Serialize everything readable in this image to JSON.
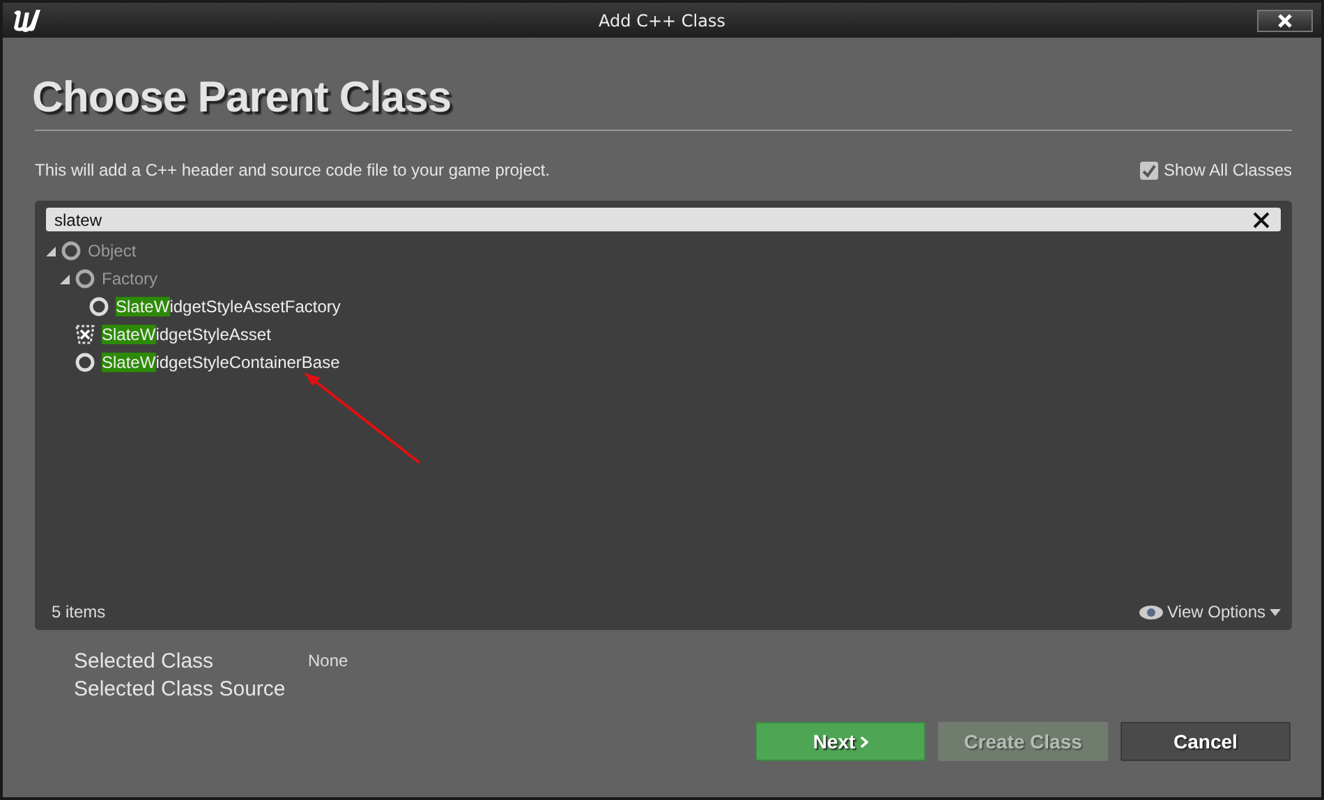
{
  "window": {
    "title": "Add C++ Class"
  },
  "heading": "Choose Parent Class",
  "description": "This will add a C++ header and source code file to your game project.",
  "show_all_classes": {
    "label": "Show All Classes",
    "checked": true
  },
  "search": {
    "value": "slatew"
  },
  "tree": [
    {
      "label_rest": "Object",
      "dimmed": true,
      "expanded": true,
      "kind": "circle",
      "children": [
        {
          "label_rest": "Factory",
          "dimmed": true,
          "expanded": true,
          "kind": "circle",
          "children": [
            {
              "label_match": "SlateW",
              "label_rest": "idgetStyleAssetFactory",
              "dimmed": false,
              "kind": "circle"
            }
          ]
        },
        {
          "label_match": "SlateW",
          "label_rest": "idgetStyleAsset",
          "dimmed": false,
          "kind": "widget"
        },
        {
          "label_match": "SlateW",
          "label_rest": "idgetStyleContainerBase",
          "dimmed": false,
          "kind": "circle"
        }
      ]
    }
  ],
  "item_count": "5 items",
  "view_options": "View Options",
  "selected_class": {
    "label": "Selected Class",
    "value": "None"
  },
  "selected_class_source": {
    "label": "Selected Class Source"
  },
  "buttons": [
    {
      "label": "Next",
      "kind": "primary",
      "disabled": false
    },
    {
      "label": "Create Class",
      "kind": "secondary",
      "disabled": true
    },
    {
      "label": "Cancel",
      "kind": "cancel",
      "disabled": false
    }
  ]
}
